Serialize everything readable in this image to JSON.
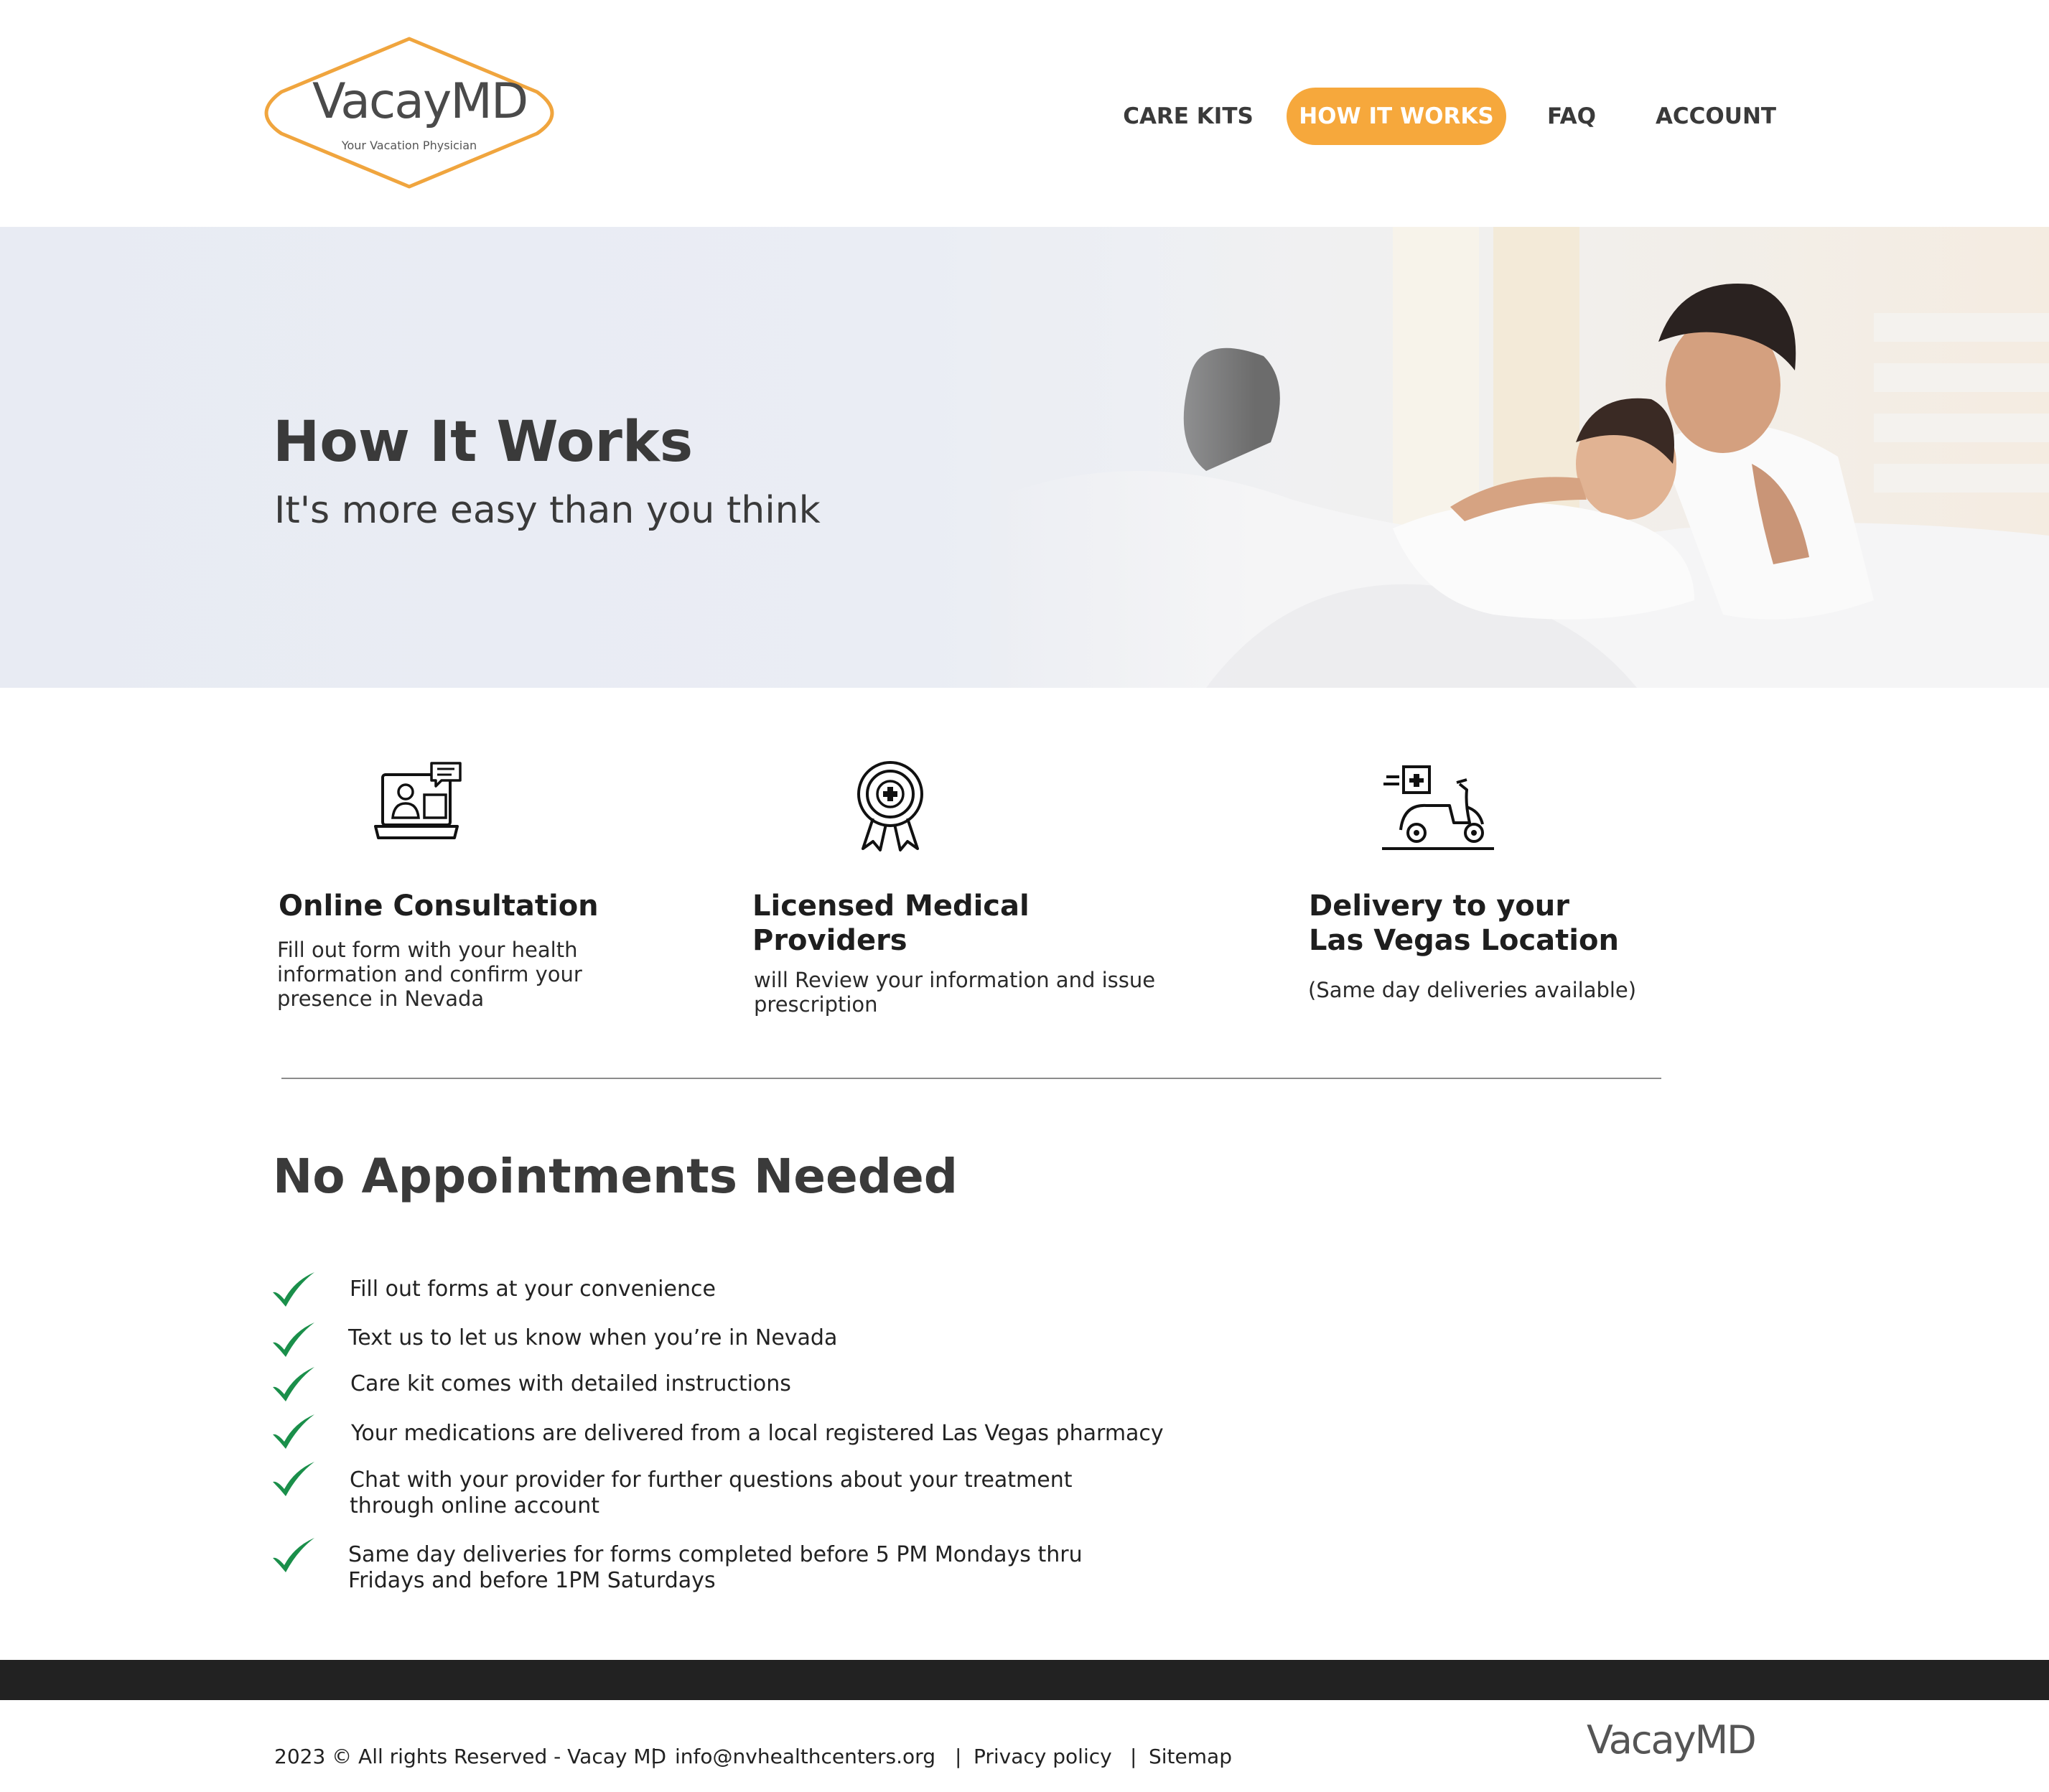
{
  "brand": {
    "name": "VacayMD",
    "tagline": "Your Vacation Physician",
    "accent": "#f6a83c",
    "check_color": "#1a8f4a",
    "footer_bg": "#222222"
  },
  "nav": {
    "items": [
      {
        "label": "CARE KITS",
        "active": false
      },
      {
        "label": "HOW IT WORKS",
        "active": true
      },
      {
        "label": "FAQ",
        "active": false
      },
      {
        "label": "ACCOUNT",
        "active": false
      }
    ]
  },
  "hero": {
    "title": "How It Works",
    "subtitle": "It's more easy than you think"
  },
  "steps": [
    {
      "icon": "online-consultation-icon",
      "title_lines": [
        "Online Consultation"
      ],
      "desc_lines": [
        "Fill out form with your health",
        "information and confirm your",
        "presence in Nevada"
      ]
    },
    {
      "icon": "medical-badge-icon",
      "title_lines": [
        "Licensed Medical",
        "Providers"
      ],
      "desc_lines": [
        "will Review your information and issue",
        "prescription"
      ]
    },
    {
      "icon": "delivery-scooter-icon",
      "title_lines": [
        "Delivery to your",
        "Las Vegas Location"
      ],
      "desc_lines": [
        "(Same day deliveries available)"
      ]
    }
  ],
  "appointments": {
    "title": "No Appointments Needed",
    "items": [
      [
        "Fill out forms at your convenience"
      ],
      [
        "Text us to let us know when you’re in Nevada"
      ],
      [
        "Care kit comes with detailed instructions"
      ],
      [
        "Your medications are delivered from a local registered Las Vegas pharmacy"
      ],
      [
        "Chat with your provider for further questions about your treatment",
        "through online account"
      ],
      [
        "Same day deliveries for forms completed before 5 PM Mondays thru",
        "Fridays and before 1PM Saturdays"
      ]
    ]
  },
  "footer": {
    "copyright": "2023 © All rights Reserved - Vacay MD",
    "email": "info@nvhealthcenters.org",
    "privacy": "Privacy policy",
    "sitemap": "Sitemap",
    "separator": "|",
    "logo": "VacayMD"
  }
}
